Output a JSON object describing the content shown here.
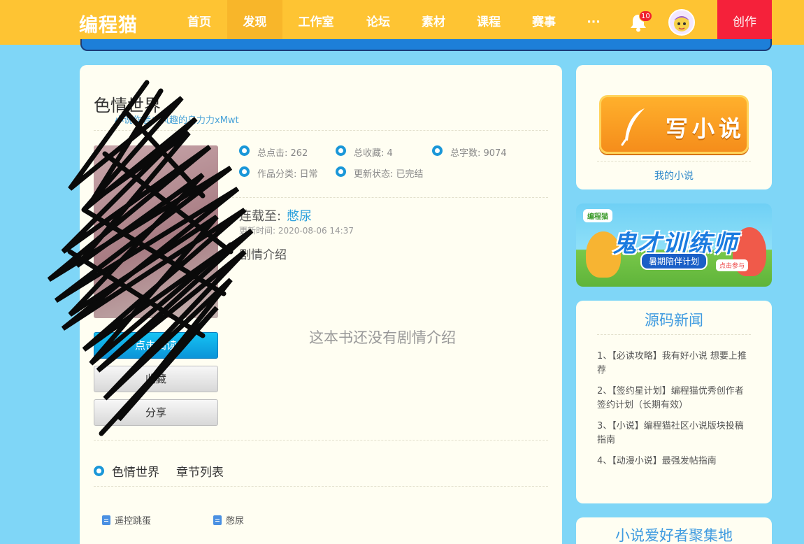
{
  "header": {
    "logo": "编程猫",
    "nav": [
      {
        "label": "首页",
        "active": false
      },
      {
        "label": "发现",
        "active": true
      },
      {
        "label": "工作室",
        "active": false
      },
      {
        "label": "论坛",
        "active": false
      },
      {
        "label": "素材",
        "active": false
      },
      {
        "label": "课程",
        "active": false
      },
      {
        "label": "赛事",
        "active": false
      }
    ],
    "more": "···",
    "notification_count": "10",
    "create_label": "创作"
  },
  "book": {
    "title": "色情世界",
    "author": "小说作者：风趣的乌力力xMwt",
    "stats": {
      "clicks": "总点击: 262",
      "favorites": "总收藏: 4",
      "words": "总字数: 9074",
      "category": "作品分类: 日常",
      "status": "更新状态: 已完结"
    },
    "latest_label": "连载至:",
    "latest_chapter": "憋尿",
    "update_time": "更新时间: 2020-08-06 14:37",
    "plot_label": "剧情介绍",
    "plot_empty": "这本书还没有剧情介绍",
    "buttons": {
      "read": "点击阅读",
      "favorite": "收藏",
      "share": "分享"
    },
    "chapter_section_name": "色情世界",
    "chapter_section_label": "章节列表",
    "chapters": [
      "遥控跳蛋",
      "憋尿"
    ]
  },
  "sidebar": {
    "write_label": "写小说",
    "my_novel": "我的小说",
    "banner": {
      "tag": "编程猫",
      "title": "鬼才训练师",
      "subtitle": "暑期陪伴计划",
      "cta": "点击参与"
    },
    "news_title": "源码新闻",
    "news": [
      "1、【必读攻略】我有好小说 想要上推荐",
      "2、【签约星计划】编程猫优秀创作者签约计划（长期有效）",
      "3、【小说】编程猫社区小说版块投稿指南",
      "4、【动漫小说】最强发帖指南"
    ],
    "gather_title": "小说爱好者聚集地"
  },
  "colors": {
    "header": "#fec433",
    "page_bg": "#7fd6f7",
    "accent_blue": "#1a97d8",
    "create_red": "#f5213a"
  }
}
